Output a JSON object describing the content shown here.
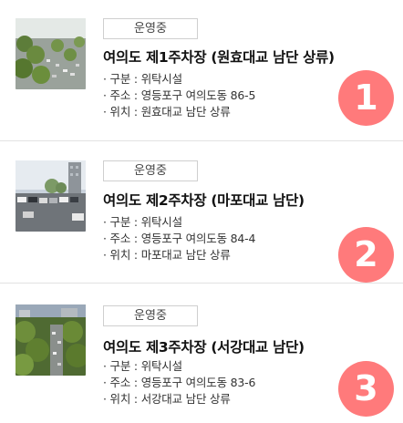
{
  "parking_lots": [
    {
      "status": "운영중",
      "title": "여의도 제1주차장 (원효대교 남단 상류)",
      "type": "· 구분 : 위탁시설",
      "address": "· 주소 : 영등포구 여의도동 86-5",
      "location": "· 위치 : 원효대교 남단 상류",
      "number": "1"
    },
    {
      "status": "운영중",
      "title": "여의도 제2주차장 (마포대교 남단)",
      "type": "· 구분 : 위탁시설",
      "address": "· 주소 : 영등포구 여의도동 84-4",
      "location": "· 위치 : 마포대교 남단 상류",
      "number": "2"
    },
    {
      "status": "운영중",
      "title": "여의도 제3주차장 (서강대교 남단)",
      "type": "· 구분 : 위탁시설",
      "address": "· 주소 : 영등포구 여의도동 83-6",
      "location": "· 위치 : 서강대교 남단 상류",
      "number": "3"
    }
  ],
  "colors": {
    "number_badge": "#ff7a7b",
    "divider": "#e2e2e2",
    "status_border": "#cfcfcf"
  }
}
